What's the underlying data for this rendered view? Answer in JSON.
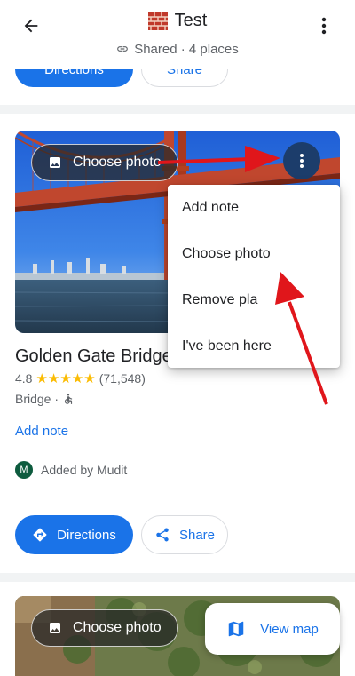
{
  "header": {
    "title": "Test",
    "subtitle": "Shared · 4 places",
    "back_icon": "arrow-back-icon",
    "more_icon": "more-vert-icon"
  },
  "partial_card": {
    "directions_label": "Directions",
    "share_label": "Share"
  },
  "place": {
    "photo_button_label": "Choose photo",
    "name": "Golden Gate Bridge",
    "rating": "4.8",
    "stars": "★★★★★",
    "reviews": "(71,548)",
    "category": "Bridge ·",
    "add_note_label": "Add note",
    "added_by_initial": "M",
    "added_by": "Added by Mudit",
    "directions_label": "Directions",
    "share_label": "Share"
  },
  "menu": {
    "items": [
      "Add note",
      "Choose photo",
      "Remove pla",
      "I've been here"
    ]
  },
  "next_card": {
    "photo_button_label": "Choose photo"
  },
  "fab": {
    "label": "View map"
  },
  "colors": {
    "accent": "#1a73e8",
    "annotation_arrow": "#e0161b",
    "star": "#fbbc04"
  }
}
